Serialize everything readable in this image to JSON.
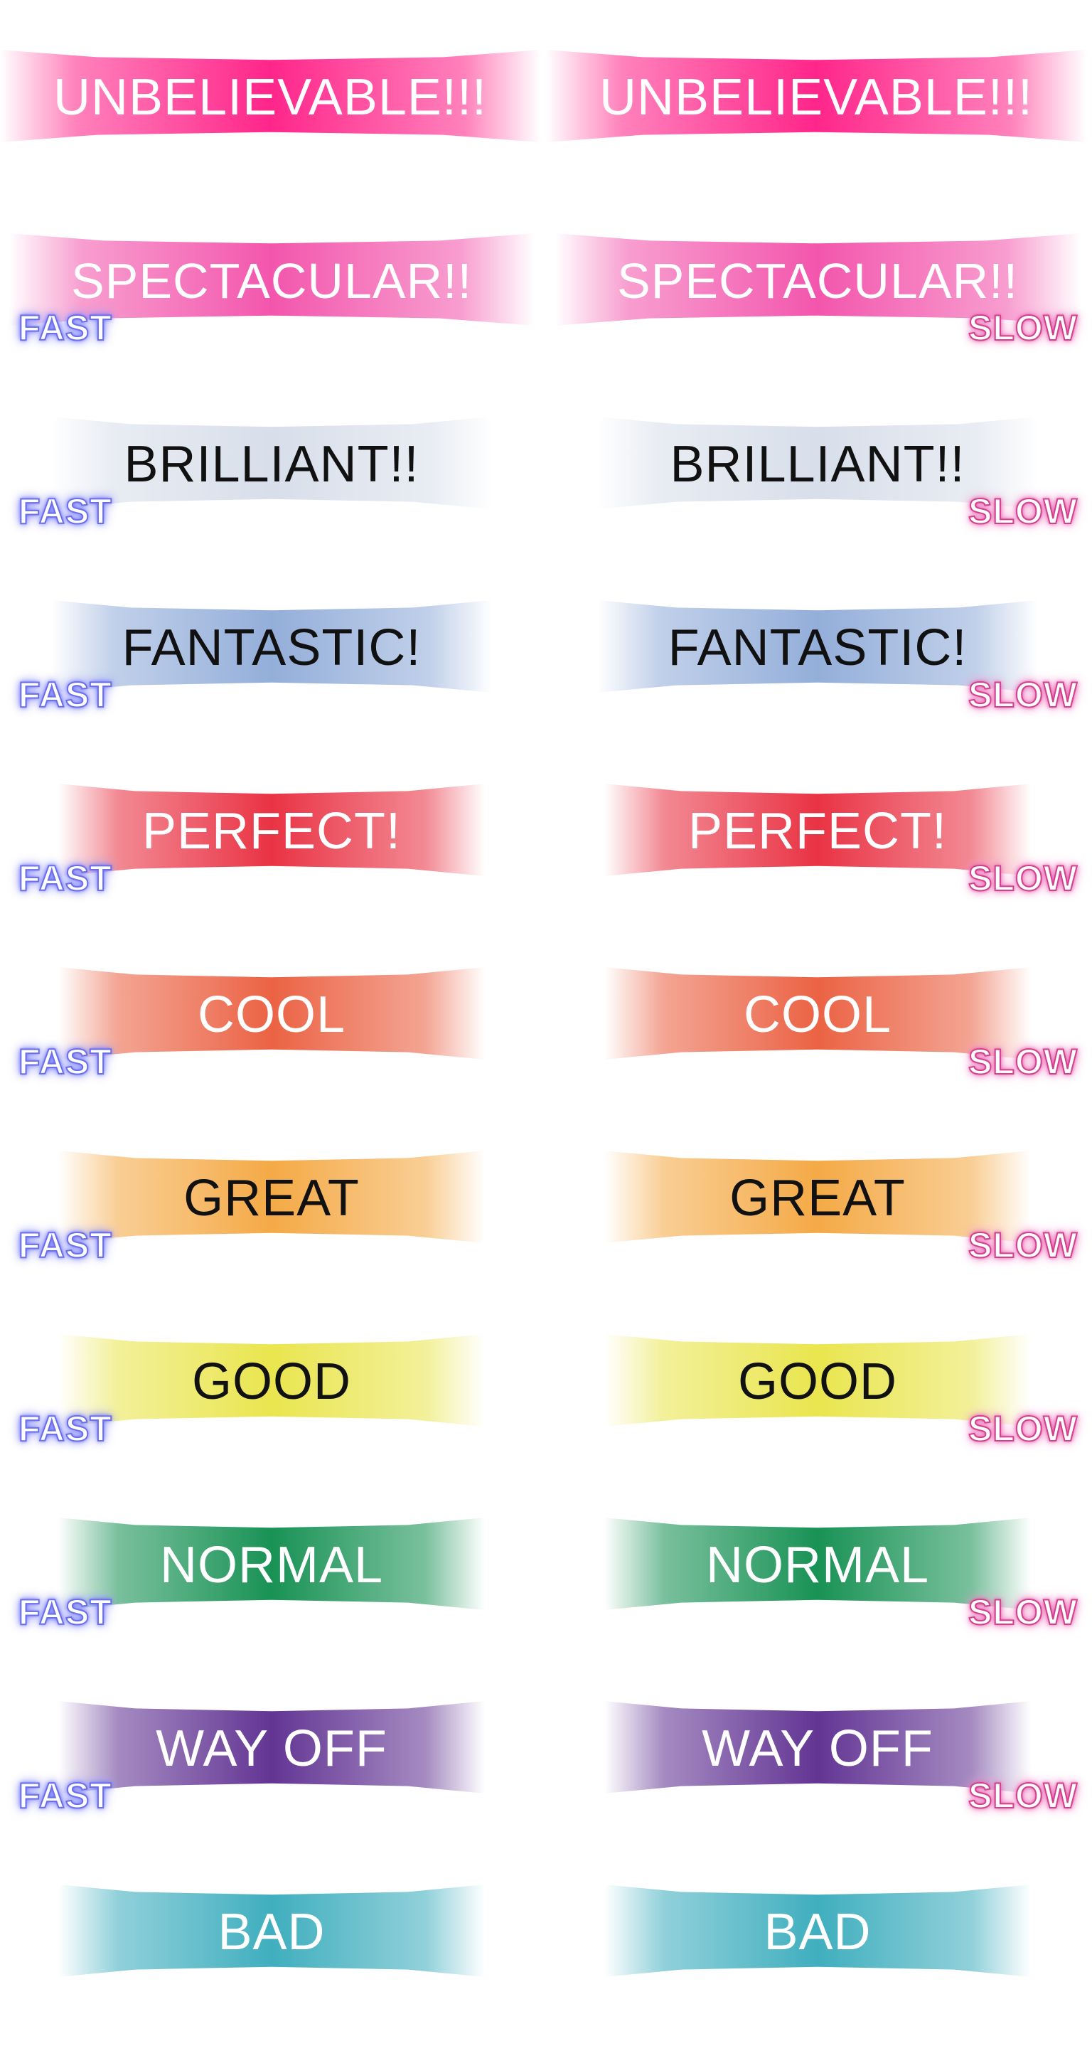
{
  "columns": [
    {
      "speed_tag": "FAST",
      "tag_class": "fast"
    },
    {
      "speed_tag": "SLOW",
      "tag_class": "slow"
    }
  ],
  "ratings": [
    {
      "label": "UNBELIEVABLE!!!",
      "color": "#ff1a84",
      "text_color": "#ffffff",
      "show_tag": false
    },
    {
      "label": "SPECTACULAR!!",
      "color": "#f24da8",
      "text_color": "#ffffff",
      "show_tag": true
    },
    {
      "label": "BRILLIANT!!",
      "color": "#d6dde9",
      "text_color": "#111111",
      "show_tag": true
    },
    {
      "label": "FANTASTIC!",
      "color": "#8eaad8",
      "text_color": "#111111",
      "show_tag": true
    },
    {
      "label": "PERFECT!",
      "color": "#e8283a",
      "text_color": "#ffffff",
      "show_tag": true
    },
    {
      "label": "COOL",
      "color": "#ea5a3a",
      "text_color": "#ffffff",
      "show_tag": true
    },
    {
      "label": "GREAT",
      "color": "#f4a53c",
      "text_color": "#111111",
      "show_tag": true
    },
    {
      "label": "GOOD",
      "color": "#e8e445",
      "text_color": "#111111",
      "show_tag": true
    },
    {
      "label": "NORMAL",
      "color": "#0c8c4c",
      "text_color": "#ffffff",
      "show_tag": true
    },
    {
      "label": "WAY OFF",
      "color": "#5a2a8e",
      "text_color": "#ffffff",
      "show_tag": true
    },
    {
      "label": "BAD",
      "color": "#35aabb",
      "text_color": "#ffffff",
      "show_tag": false
    }
  ]
}
